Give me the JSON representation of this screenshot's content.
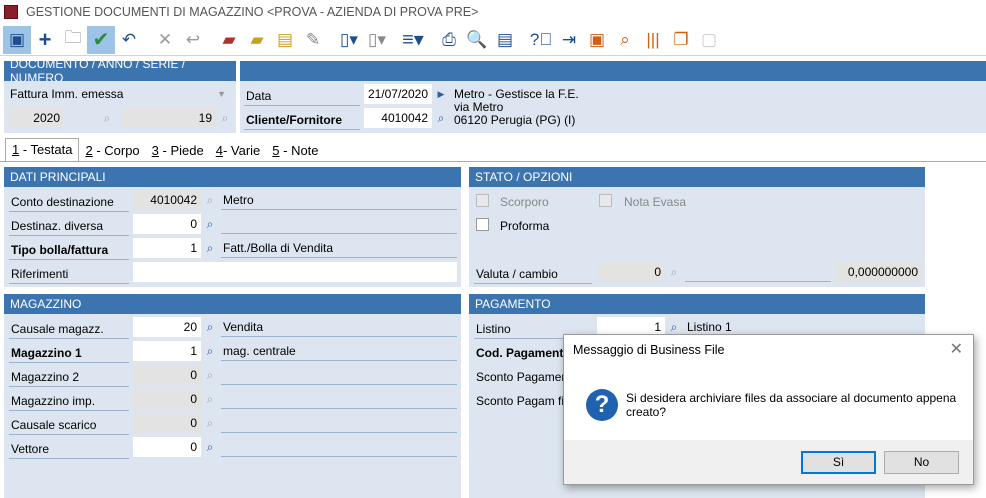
{
  "window": {
    "title": "GESTIONE DOCUMENTI DI MAGAZZINO <PROVA - AZIENDA DI PROVA PRE>"
  },
  "toolbar": {
    "icons": [
      "panel-icon",
      "add-icon",
      "open-folder-icon",
      "confirm-check-icon",
      "undo-icon",
      "delete-icon",
      "revert-icon",
      "folder-red-icon",
      "folder-yellow-icon",
      "document-yellow-icon",
      "ruler-icon",
      "new-document-icon",
      "blank-document-icon",
      "menu-icon",
      "print-icon",
      "print-preview-icon",
      "pdf-icon",
      "help-icon",
      "exit-icon",
      "archive-icon",
      "search-archive-icon",
      "barcode-icon",
      "copies-icon",
      "disabled-icon"
    ]
  },
  "doc_header": {
    "title": "DOCUMENTO / ANNO / SERIE / NUMERO",
    "doc_type": "Fattura Imm. emessa",
    "year": "2020",
    "number": "19",
    "date_label": "Data",
    "date_value": "21/07/2020",
    "customer_label": "Cliente/Fornitore",
    "customer_code": "4010042",
    "customer_line1": "Metro  - Gestisce la F.E.",
    "customer_line2": "via Metro",
    "customer_line3": "06120 Perugia (PG)   (I)"
  },
  "tabs": [
    {
      "key": "1",
      "label": " - Testata"
    },
    {
      "key": "2",
      "label": " - Corpo"
    },
    {
      "key": "3",
      "label": " - Piede"
    },
    {
      "key": "4",
      "label": "- Varie"
    },
    {
      "key": "5",
      "label": " - Note"
    }
  ],
  "dati_principali": {
    "title": "DATI PRINCIPALI",
    "conto_label": "Conto destinazione",
    "conto_value": "4010042",
    "conto_desc": "Metro",
    "destinaz_label": "Destinaz. diversa",
    "destinaz_value": "0",
    "tipo_label": "Tipo bolla/fattura",
    "tipo_value": "1",
    "tipo_desc": "Fatt./Bolla di Vendita",
    "riferimenti_label": "Riferimenti"
  },
  "stato": {
    "title": "STATO / OPZIONI",
    "scorporo": "Scorporo",
    "nota_evasa": "Nota Evasa",
    "proforma": "Proforma",
    "valuta_label": "Valuta / cambio",
    "valuta_value": "0",
    "cambio_value": "0,000000000"
  },
  "magazzino": {
    "title": "MAGAZZINO",
    "causale_label": "Causale magazz.",
    "causale_value": "20",
    "causale_desc": "Vendita",
    "mag1_label": "Magazzino 1",
    "mag1_value": "1",
    "mag1_desc": "mag. centrale",
    "mag2_label": "Magazzino 2",
    "mag2_value": "0",
    "magimp_label": "Magazzino imp.",
    "magimp_value": "0",
    "caus_scarico_label": "Causale scarico",
    "caus_scarico_value": "0",
    "vettore_label": "Vettore",
    "vettore_value": "0"
  },
  "pagamento": {
    "title": "PAGAMENTO",
    "listino_label": "Listino",
    "listino_value": "1",
    "listino_desc": "Listino 1",
    "cod_label": "Cod. Pagamento",
    "sconto1_label": "Sconto Pagamento",
    "sconto2_label": "Sconto Pagam fina"
  },
  "dialog": {
    "title": "Messaggio di Business File",
    "message_line1": "Si desidera archiviare files da associare al documento appena",
    "message_line2": "creato?",
    "yes_label": "Sì",
    "no_label": "No"
  }
}
